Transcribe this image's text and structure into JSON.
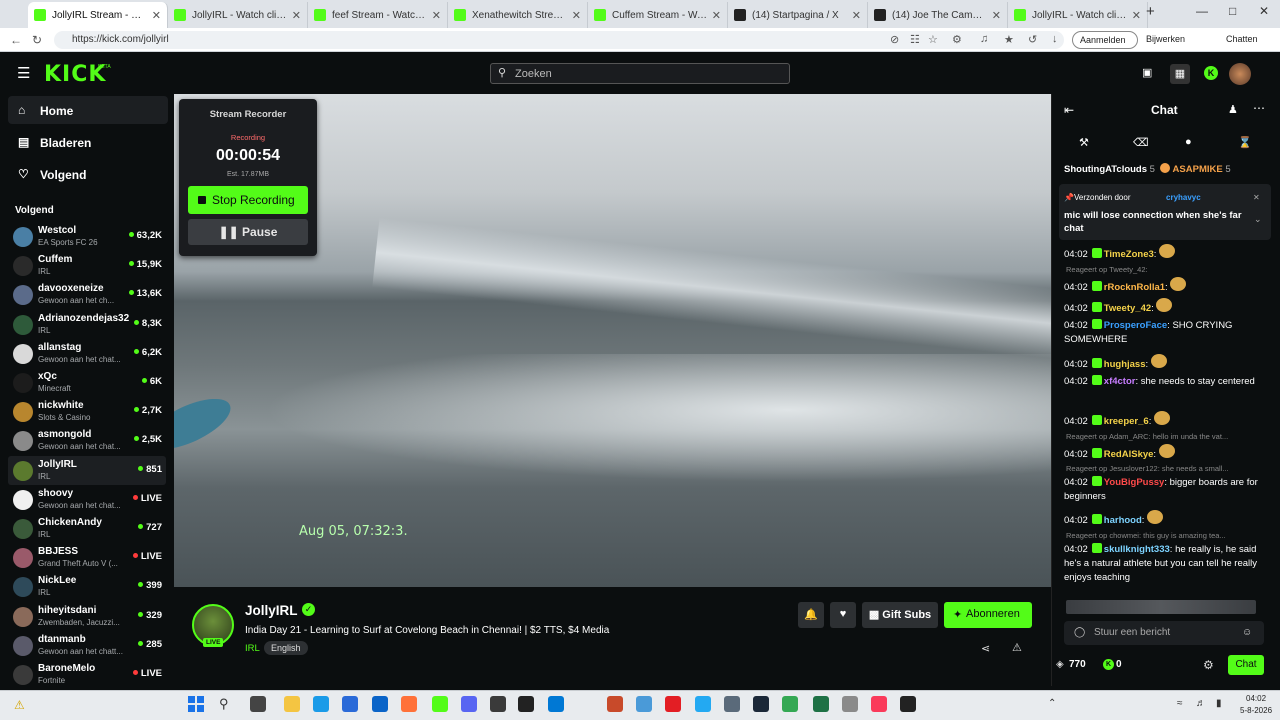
{
  "browser": {
    "tabs": [
      {
        "title": "JollyIRL Stream - Watch",
        "active": true,
        "color": "#53fc18"
      },
      {
        "title": "JollyIRL - Watch clips on Kick",
        "active": false,
        "color": "#53fc18"
      },
      {
        "title": "feef Stream - Watch Live on",
        "active": false,
        "color": "#53fc18"
      },
      {
        "title": "Xenathewitch Stream - Wat",
        "active": false,
        "color": "#53fc18"
      },
      {
        "title": "Cuffem Stream - Watch Live",
        "active": false,
        "color": "#53fc18"
      },
      {
        "title": "(14) Startpagina / X",
        "active": false,
        "color": "#222222"
      },
      {
        "title": "(14) Joe The Camel op X: 'Sa",
        "active": false,
        "color": "#222222"
      },
      {
        "title": "JollyIRL - Watch clips on Kick",
        "active": false,
        "color": "#53fc18"
      }
    ],
    "url": "https://kick.com/jollyirl",
    "signin_label": "Aanmelden",
    "update_label": "Bijwerken",
    "chat_label": "Chatten"
  },
  "header": {
    "logo": "KICK",
    "beta": "BETA",
    "search_placeholder": "Zoeken"
  },
  "sidebar": {
    "nav": [
      {
        "label": "Home",
        "icon": "home-icon"
      },
      {
        "label": "Bladeren",
        "icon": "browse-icon"
      },
      {
        "label": "Volgend",
        "icon": "heart-icon"
      }
    ],
    "following_title": "Volgend",
    "channels": [
      {
        "name": "Westcol",
        "sub": "EA Sports FC 26",
        "viewers": "63,2K",
        "color": "#4a7fa5"
      },
      {
        "name": "Cuffem",
        "sub": "IRL",
        "viewers": "15,9K",
        "color": "#2a2a2a"
      },
      {
        "name": "davooxeneize",
        "sub": "Gewoon aan het ch...",
        "viewers": "13,6K",
        "color": "#5b6b8a"
      },
      {
        "name": "Adrianozendejas32",
        "sub": "IRL",
        "viewers": "8,3K",
        "color": "#2e5a3a"
      },
      {
        "name": "allanstag",
        "sub": "Gewoon aan het chat...",
        "viewers": "6,2K",
        "color": "#d9d9d9"
      },
      {
        "name": "xQc",
        "sub": "Minecraft",
        "viewers": "6K",
        "color": "#1c1c1c"
      },
      {
        "name": "nickwhite",
        "sub": "Slots & Casino",
        "viewers": "2,7K",
        "color": "#b8862e"
      },
      {
        "name": "asmongold",
        "sub": "Gewoon aan het chat...",
        "viewers": "2,5K",
        "color": "#8a8a8a"
      },
      {
        "name": "JollyIRL",
        "sub": "IRL",
        "viewers": "851",
        "color": "#5b7a2e",
        "active": true
      },
      {
        "name": "shoovy",
        "sub": "Gewoon aan het chat...",
        "viewers": "LIVE",
        "color": "#f0f0f0"
      },
      {
        "name": "ChickenAndy",
        "sub": "IRL",
        "viewers": "727",
        "color": "#3a5a3a"
      },
      {
        "name": "BBJESS",
        "sub": "Grand Theft Auto V (...",
        "viewers": "LIVE",
        "color": "#9a5a6a"
      },
      {
        "name": "NickLee",
        "sub": "IRL",
        "viewers": "399",
        "color": "#2e4a5a"
      },
      {
        "name": "hiheyitsdani",
        "sub": "Zwembaden, Jacuzzi...",
        "viewers": "329",
        "color": "#8a6a5a"
      },
      {
        "name": "dtanmanb",
        "sub": "Gewoon aan het chatt...",
        "viewers": "285",
        "color": "#5a5a6a"
      },
      {
        "name": "BaroneMelo",
        "sub": "Fortnite",
        "viewers": "LIVE",
        "color": "#3a3a3a"
      }
    ]
  },
  "video": {
    "timestamp": "Aug 05, 07:32:3."
  },
  "recorder": {
    "title": "Stream Recorder",
    "status": "Recording",
    "time": "00:00:54",
    "size": "Est. 17.87MB",
    "stop_label": "Stop Recording",
    "pause_label": "Pause"
  },
  "stream": {
    "name": "JollyIRL",
    "live": "LIVE",
    "title": "India Day 21 - Learning to Surf at Covelong Beach in Chennai! | $2 TTS, $4 Media",
    "category": "IRL",
    "language": "English",
    "gift_label": "Gift Subs",
    "subscribe_label": "Abonneren"
  },
  "chat": {
    "title": "Chat",
    "top_user_1": "ShoutingATclouds",
    "top_user_1_count": "5",
    "top_user_2": "ASAPMIKE",
    "top_user_2_count": "5",
    "pinned_by": "Verzonden door",
    "pinned_user": "cryhavyc",
    "pinned_text": "mic will lose connection when she's far chat",
    "messages": [
      {
        "time": "04:02",
        "user": "TimeZone3",
        "text": "",
        "color": "#f4d24a"
      },
      {
        "time": "04:02",
        "user": "rRocknRolla1",
        "text": "",
        "color": "#ffb84a",
        "reply": "Reageert op Tweety_42:"
      },
      {
        "time": "04:02",
        "user": "Tweety_42",
        "text": "",
        "color": "#f4d24a"
      },
      {
        "time": "04:02",
        "user": "ProsperoFace",
        "text": "SHO CRYING SOMEWHERE",
        "color": "#3aa0ff"
      },
      {
        "time": "04:02",
        "user": "hughjass",
        "text": "",
        "color": "#f4d24a"
      },
      {
        "time": "04:02",
        "user": "xf4ctor",
        "text": "she needs to stay centered",
        "color": "#c77dff"
      },
      {
        "time": "04:02",
        "user": "kreeper_6",
        "text": "",
        "color": "#f4d24a"
      },
      {
        "time": "04:02",
        "user": "RedAlSkye",
        "text": "",
        "color": "#f4d24a",
        "reply": "Reageert op Adam_ARC: hello im unda the vat..."
      },
      {
        "time": "04:02",
        "user": "YouBigPussy",
        "text": "bigger boards are for beginners",
        "color": "#ff4a4a",
        "reply": "Reageert op Jesuslover122: she needs a small..."
      },
      {
        "time": "04:02",
        "user": "harhood",
        "text": "",
        "color": "#7dd3ff"
      },
      {
        "time": "04:02",
        "user": "skullknight333",
        "text": "he really is, he said he's a natural athlete but you can tell he really enjoys teaching",
        "color": "#7dd3ff",
        "reply": "Reageert op chowmei: this guy is amazing tea..."
      }
    ],
    "input_placeholder": "Stuur een bericht",
    "points": "770",
    "kicks": "0",
    "send_label": "Chat"
  },
  "taskbar": {
    "time": "04:02",
    "date": "5-8-2026"
  }
}
